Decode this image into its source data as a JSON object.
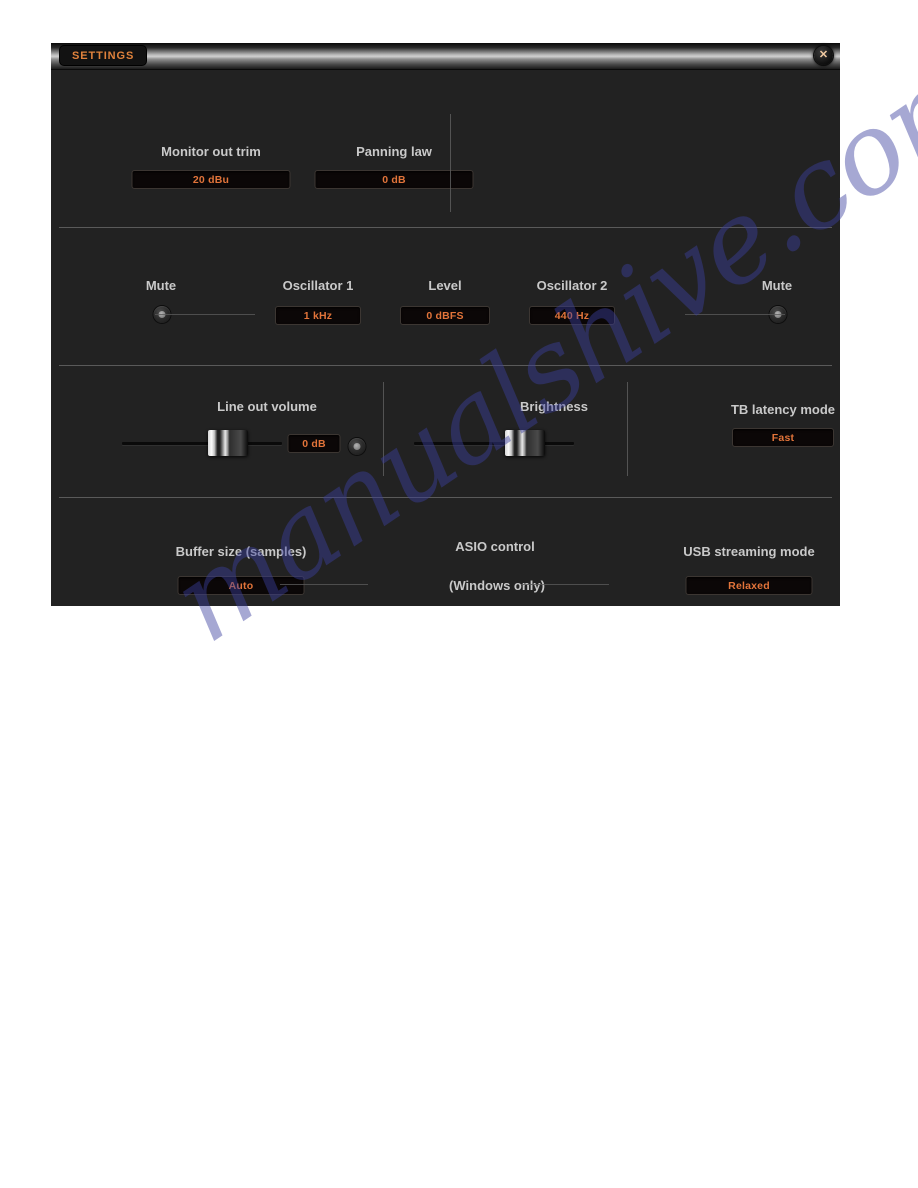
{
  "window": {
    "title": "SETTINGS",
    "close_icon": "close-x-icon"
  },
  "watermark": {
    "text": "manualshive.com",
    "color": "#3b3f9e"
  },
  "colors": {
    "panel_bg": "#222222",
    "value_text": "#e2743a",
    "label_text": "#c9c9c9",
    "title_text": "#e0823c"
  },
  "sections": {
    "output": {
      "monitor_out_trim": {
        "label": "Monitor out trim",
        "value": "20 dBu"
      },
      "panning_law": {
        "label": "Panning law",
        "value": "0 dB"
      }
    },
    "oscillators": {
      "mute_left": {
        "label": "Mute"
      },
      "oscillator_1": {
        "label": "Oscillator 1",
        "value": "1 kHz"
      },
      "level": {
        "label": "Level",
        "value": "0 dBFS"
      },
      "oscillator_2": {
        "label": "Oscillator 2",
        "value": "440 Hz"
      },
      "mute_right": {
        "label": "Mute"
      }
    },
    "levels": {
      "line_out_volume": {
        "label": "Line out volume",
        "value": "0 dB",
        "slider_position_pct": 72
      },
      "brightness": {
        "label": "Brightness",
        "slider_position_pct": 76
      },
      "tb_latency_mode": {
        "label": "TB latency mode",
        "value": "Fast"
      }
    },
    "driver": {
      "buffer_size": {
        "label": "Buffer size (samples)",
        "value": "Auto"
      },
      "asio_control": {
        "label": "ASIO control",
        "sublabel": "(Windows only)"
      },
      "usb_streaming_mode": {
        "label": "USB streaming mode",
        "value": "Relaxed"
      }
    }
  }
}
